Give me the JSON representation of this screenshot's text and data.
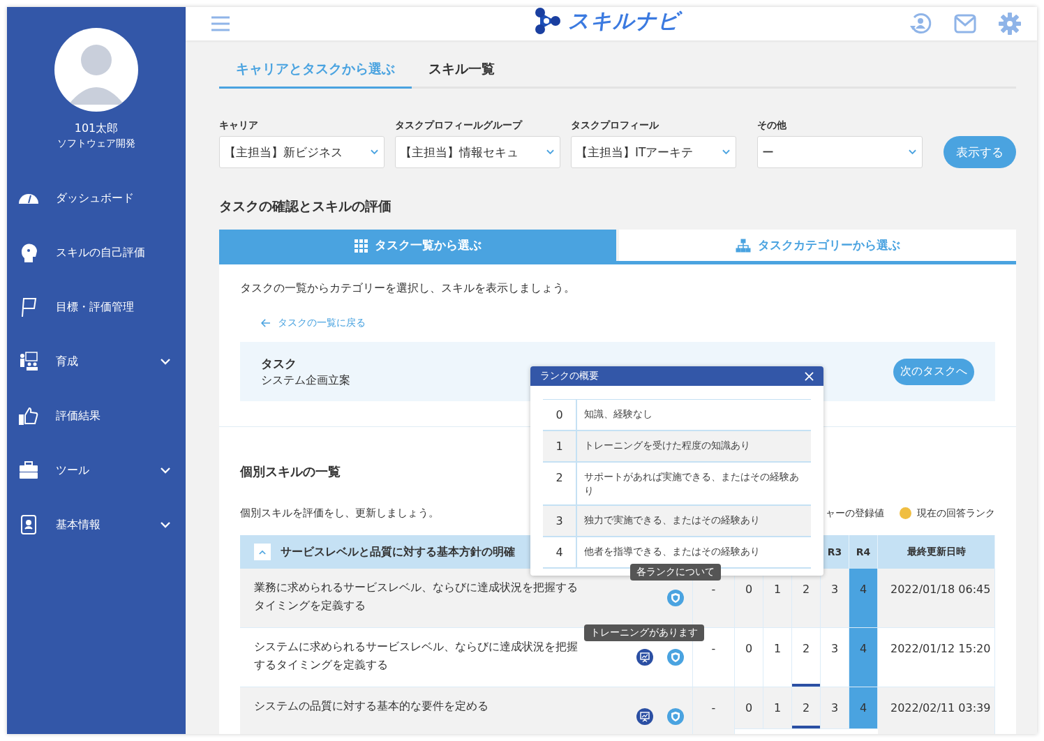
{
  "sidebar": {
    "user": {
      "name": "101太郎",
      "department": "ソフトウェア開発"
    },
    "items": [
      {
        "label": "ダッシュボード",
        "expandable": false
      },
      {
        "label": "スキルの自己評価",
        "expandable": false
      },
      {
        "label": "目標・評価管理",
        "expandable": false
      },
      {
        "label": "育成",
        "expandable": true
      },
      {
        "label": "評価結果",
        "expandable": false
      },
      {
        "label": "ツール",
        "expandable": true
      },
      {
        "label": "基本情報",
        "expandable": true
      }
    ]
  },
  "header": {
    "logo": "スキルナビ"
  },
  "tabs": [
    {
      "label": "キャリアとタスクから選ぶ",
      "selected": true
    },
    {
      "label": "スキル一覧",
      "selected": false
    }
  ],
  "filters": [
    {
      "label": "キャリア",
      "value": "【主担当】新ビジネス"
    },
    {
      "label": "タスクプロフィールグループ",
      "value": "【主担当】情報セキュ"
    },
    {
      "label": "タスクプロフィール",
      "value": "【主担当】ITアーキテ"
    },
    {
      "label": "その他",
      "value": "ー"
    }
  ],
  "show_button": "表示する",
  "section_title": "タスクの確認とスキルの評価",
  "sub_tabs": [
    {
      "label": "タスク一覧から選ぶ",
      "selected": true
    },
    {
      "label": "タスクカテゴリーから選ぶ",
      "selected": false
    }
  ],
  "instruction": "タスクの一覧からカテゴリーを選択し、スキルを表示しましょう。",
  "back_link": "タスクの一覧に戻る",
  "task": {
    "heading": "タスク",
    "name": "システム企画立案",
    "next_button": "次のタスクへ"
  },
  "skills_title": "個別スキルの一覧",
  "skills_description": "個別スキルを評価をし、更新しましょう。",
  "legend": [
    {
      "label": "ャーの登録値"
    },
    {
      "label": "現在の回答ランク",
      "color": "#f0be41"
    }
  ],
  "table": {
    "group_title": "サービスレベルと品質に対する基本方針の明確",
    "group_expanded": true,
    "columns": [
      "R3",
      "R4",
      "最終更新日時"
    ],
    "rows": [
      {
        "skill": "業務に求められるサービスレベル、ならびに達成状況を把握するタイミングを定義する",
        "training": false,
        "column_3": "-",
        "ranks": [
          {
            "value": "0",
            "registered": false,
            "answer": false
          },
          {
            "value": "1",
            "registered": false,
            "answer": false
          },
          {
            "value": "2",
            "registered": false,
            "answer": false
          },
          {
            "value": "3",
            "registered": false,
            "answer": false
          },
          {
            "value": "4",
            "registered": true,
            "answer": false
          }
        ],
        "date": "2022/01/18 06:45"
      },
      {
        "skill": "システムに求められるサービスレベル、ならびに達成状況を把握するタイミングを定義する",
        "training": true,
        "column_3": "-",
        "ranks": [
          {
            "value": "0",
            "registered": false,
            "answer": false
          },
          {
            "value": "1",
            "registered": false,
            "answer": false
          },
          {
            "value": "2",
            "registered": false,
            "answer": true
          },
          {
            "value": "3",
            "registered": false,
            "answer": false
          },
          {
            "value": "4",
            "registered": true,
            "answer": false
          }
        ],
        "date": "2022/01/12 15:20"
      },
      {
        "skill": "システムの品質に対する基本的な要件を定める",
        "training": true,
        "column_3": "-",
        "ranks": [
          {
            "value": "0",
            "registered": false,
            "answer": false
          },
          {
            "value": "1",
            "registered": false,
            "answer": false
          },
          {
            "value": "2",
            "registered": false,
            "answer": true
          },
          {
            "value": "3",
            "registered": false,
            "answer": false
          },
          {
            "value": "4",
            "registered": true,
            "answer": false
          }
        ],
        "date": "2022/02/11 03:39"
      }
    ]
  },
  "rank_popup": {
    "title": "ランクの概要",
    "ranks": [
      {
        "rank": "0",
        "description": "知識、経験なし"
      },
      {
        "rank": "1",
        "description": "トレーニングを受けた程度の知識あり"
      },
      {
        "rank": "2",
        "description": "サポートがあれば実施できる、またはその経験あり"
      },
      {
        "rank": "3",
        "description": "独力で実施できる、またはその経験あり"
      },
      {
        "rank": "4",
        "description": "他者を指導できる、またはその経験あり"
      }
    ]
  },
  "tooltips": [
    {
      "text": "各ランクについて"
    },
    {
      "text": "トレーニングがあります"
    }
  ]
}
